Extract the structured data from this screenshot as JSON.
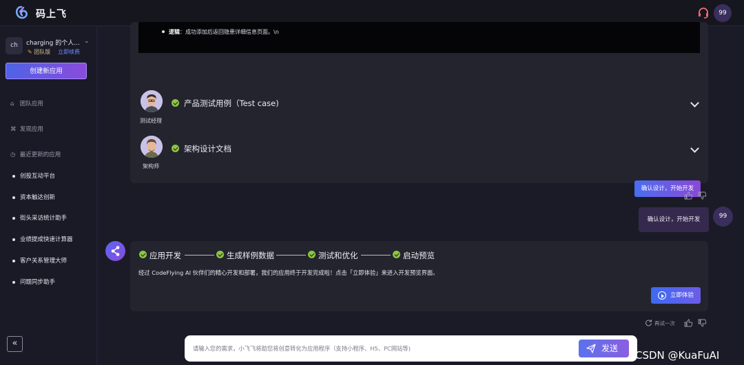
{
  "topbar": {
    "app_name": "码上飞",
    "avatar_text": "99"
  },
  "sidebar": {
    "workspace_avatar": "ch",
    "workspace_name": "charging 的个人...",
    "plan": "团队版",
    "renew": "立即续费",
    "create_button": "创建新应用",
    "nav": {
      "team_apps": "团队应用",
      "discover": "发现应用",
      "recent": "最近更新的应用"
    },
    "recent_apps": [
      "创投互动平台",
      "资本触达创新",
      "街头采访统计助手",
      "业绩提成快速计算器",
      "客户关系管理大师",
      "问题同步助手"
    ],
    "collapse_icon": "«"
  },
  "chat": {
    "code_line_label": "逻辑",
    "code_line_text": "：成功添加后返回隐患详细信息页面。\\n",
    "docs": [
      {
        "role": "测试经理",
        "title": "产品测试用例（Test case)"
      },
      {
        "role": "架构师",
        "title": "架构设计文档"
      }
    ],
    "confirm_button": "确认设计，开始开发",
    "user_message": "确认设计，开始开发",
    "user_avatar": "99",
    "steps": [
      "应用开发",
      "生成样例数据",
      "测试和优化",
      "启动预览"
    ],
    "result_text": "经过 CodeFlying AI 伙伴们的精心开发和部署，我们的应用终于开发完成啦！点击「立即体验」来进入开发预览界面。",
    "try_button": "立即体验",
    "retry_label": "再试一次"
  },
  "input": {
    "placeholder": "请输入您的需求，小飞飞将助您将创意转化为应用程序（支持小程序、H5、PC网站等)",
    "send_button": "发送"
  },
  "watermark": "CSDN @KuaFuAI",
  "colors": {
    "accent_gradient_start": "#4e63e6",
    "accent_gradient_end": "#8a4bdc",
    "check_green": "#8cc63f",
    "background": "#1b1b27"
  }
}
